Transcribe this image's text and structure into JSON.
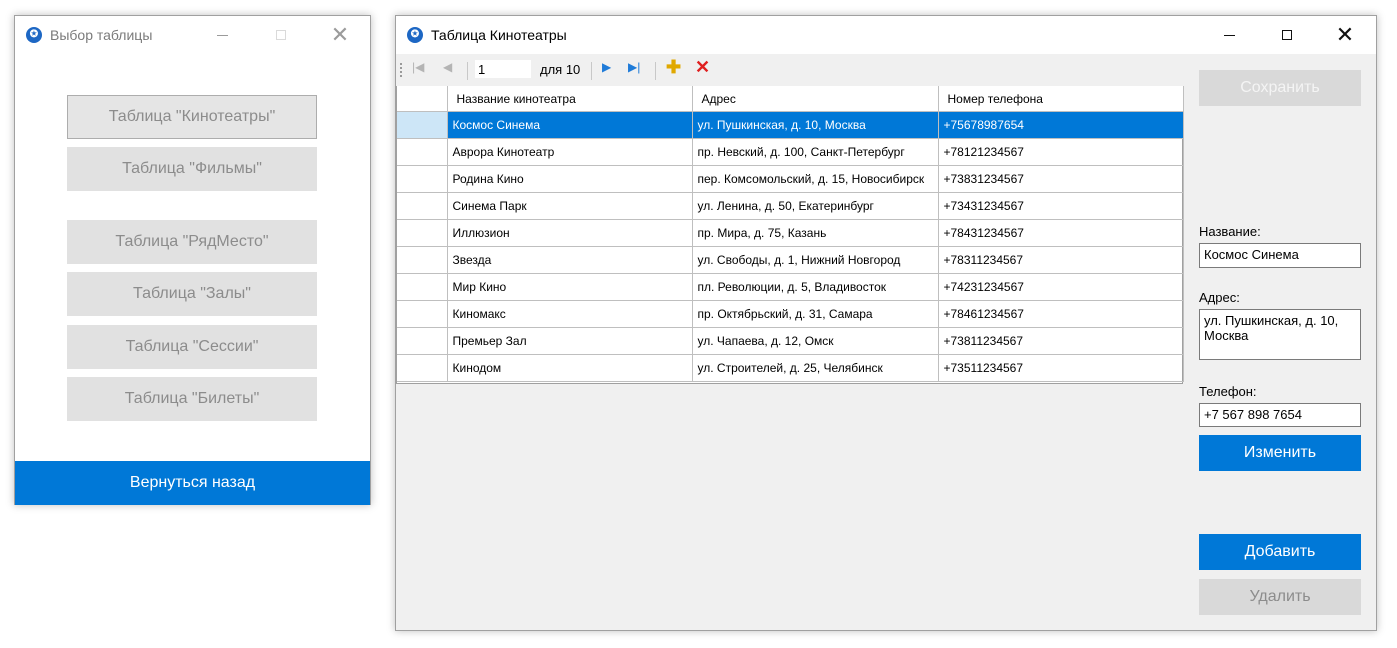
{
  "window1": {
    "title": "Выбор таблицы",
    "buttons": [
      "Таблица \"Кинотеатры\"",
      "Таблица \"Фильмы\"",
      "Таблица \"РядМесто\"",
      "Таблица \"Залы\"",
      "Таблица \"Сессии\"",
      "Таблица \"Билеты\""
    ],
    "back_label": "Вернуться назад"
  },
  "window2": {
    "title": "Таблица Кинотеатры",
    "navigator": {
      "position": "1",
      "count_label": "для 10"
    },
    "grid": {
      "columns": [
        "Название кинотеатра",
        "Адрес",
        "Номер телефона"
      ],
      "rows": [
        [
          "Космос Синема",
          "ул. Пушкинская, д. 10, Москва",
          "+75678987654"
        ],
        [
          "Аврора Кинотеатр",
          "пр. Невский, д. 100, Санкт-Петербург",
          "+78121234567"
        ],
        [
          "Родина Кино",
          "пер. Комсомольский, д. 15, Новосибирск",
          "+73831234567"
        ],
        [
          "Синема Парк",
          "ул. Ленина, д. 50, Екатеринбург",
          "+73431234567"
        ],
        [
          "Иллюзион",
          "пр. Мира, д. 75, Казань",
          "+78431234567"
        ],
        [
          "Звезда",
          "ул. Свободы, д. 1, Нижний Новгород",
          "+78311234567"
        ],
        [
          "Мир Кино",
          "пл. Революции, д. 5, Владивосток",
          "+74231234567"
        ],
        [
          "Киномакс",
          "пр. Октябрьский, д. 31, Самара",
          "+78461234567"
        ],
        [
          "Премьер Зал",
          "ул. Чапаева, д. 12, Омск",
          "+73811234567"
        ],
        [
          "Кинодом",
          "ул. Строителей, д. 25, Челябинск",
          "+73511234567"
        ]
      ]
    },
    "side": {
      "save_label": "Сохранить",
      "name_label": "Название:",
      "name_value": "Космос Синема",
      "address_label": "Адрес:",
      "address_value": "ул. Пушкинская, д. 10, Москва",
      "phone_label": "Телефон:",
      "phone_value": "+7 567 898 7654",
      "edit_label": "Изменить",
      "add_label": "Добавить",
      "delete_label": "Удалить"
    }
  }
}
